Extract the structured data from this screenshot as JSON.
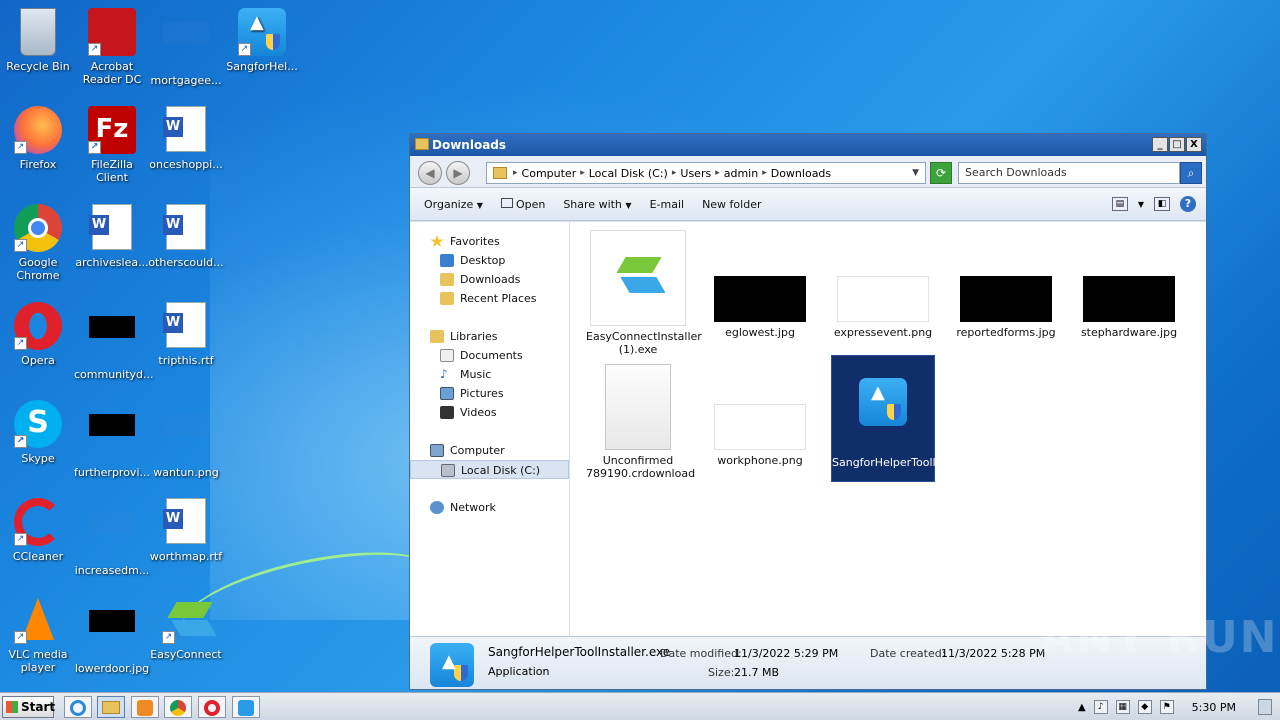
{
  "desktop": {
    "icons": [
      {
        "label": "Recycle Bin"
      },
      {
        "label": "Acrobat Reader DC"
      },
      {
        "label": "mortgagee..."
      },
      {
        "label": "SangforHel..."
      },
      {
        "label": "Firefox"
      },
      {
        "label": "FileZilla Client"
      },
      {
        "label": "onceshoppi..."
      },
      {
        "label": "Google Chrome"
      },
      {
        "label": "archiveslea..."
      },
      {
        "label": "otherscould..."
      },
      {
        "label": "Opera"
      },
      {
        "label": "communityd..."
      },
      {
        "label": "tripthis.rtf"
      },
      {
        "label": "Skype"
      },
      {
        "label": "furtherprovi..."
      },
      {
        "label": "wantun.png"
      },
      {
        "label": "CCleaner"
      },
      {
        "label": "increasedm..."
      },
      {
        "label": "worthmap.rtf"
      },
      {
        "label": "VLC media player"
      },
      {
        "label": "lowerdoor.jpg"
      },
      {
        "label": "EasyConnect"
      }
    ]
  },
  "window": {
    "title": "Downloads",
    "minimize": "_",
    "maximize": "□",
    "close": "X",
    "breadcrumb": [
      "Computer",
      "Local Disk (C:)",
      "Users",
      "admin",
      "Downloads"
    ],
    "search_placeholder": "Search Downloads",
    "toolbar": {
      "organize": "Organize",
      "open": "Open",
      "share_with": "Share with",
      "email": "E-mail",
      "new_folder": "New folder"
    },
    "nav": {
      "favorites": "Favorites",
      "desktop": "Desktop",
      "downloads": "Downloads",
      "recent_places": "Recent Places",
      "libraries": "Libraries",
      "documents": "Documents",
      "music": "Music",
      "pictures": "Pictures",
      "videos": "Videos",
      "computer": "Computer",
      "local_disk": "Local Disk (C:)",
      "network": "Network"
    },
    "files": [
      {
        "name": "EasyConnectInstaller (1).exe"
      },
      {
        "name": "eglowest.jpg"
      },
      {
        "name": "expressevent.png"
      },
      {
        "name": "reportedforms.jpg"
      },
      {
        "name": "stephardware.jpg"
      },
      {
        "name": "Unconfirmed 789190.crdownload"
      },
      {
        "name": "workphone.png"
      },
      {
        "name": "SangforHelperToolInstaller.exe"
      }
    ],
    "details": {
      "filename": "SangforHelperToolInstaller.exe",
      "type": "Application",
      "date_modified_label": "Date modified:",
      "date_modified": "11/3/2022 5:29 PM",
      "date_created_label": "Date created:",
      "date_created": "11/3/2022 5:28 PM",
      "size_label": "Size:",
      "size": "21.7 MB"
    }
  },
  "taskbar": {
    "start_label": "Start",
    "clock": "5:30 PM"
  },
  "watermark": "ANY RUN",
  "colors": {
    "selection": "#102e6a",
    "titlebar": "#1d56a8",
    "desktop": "#1a86e0"
  }
}
